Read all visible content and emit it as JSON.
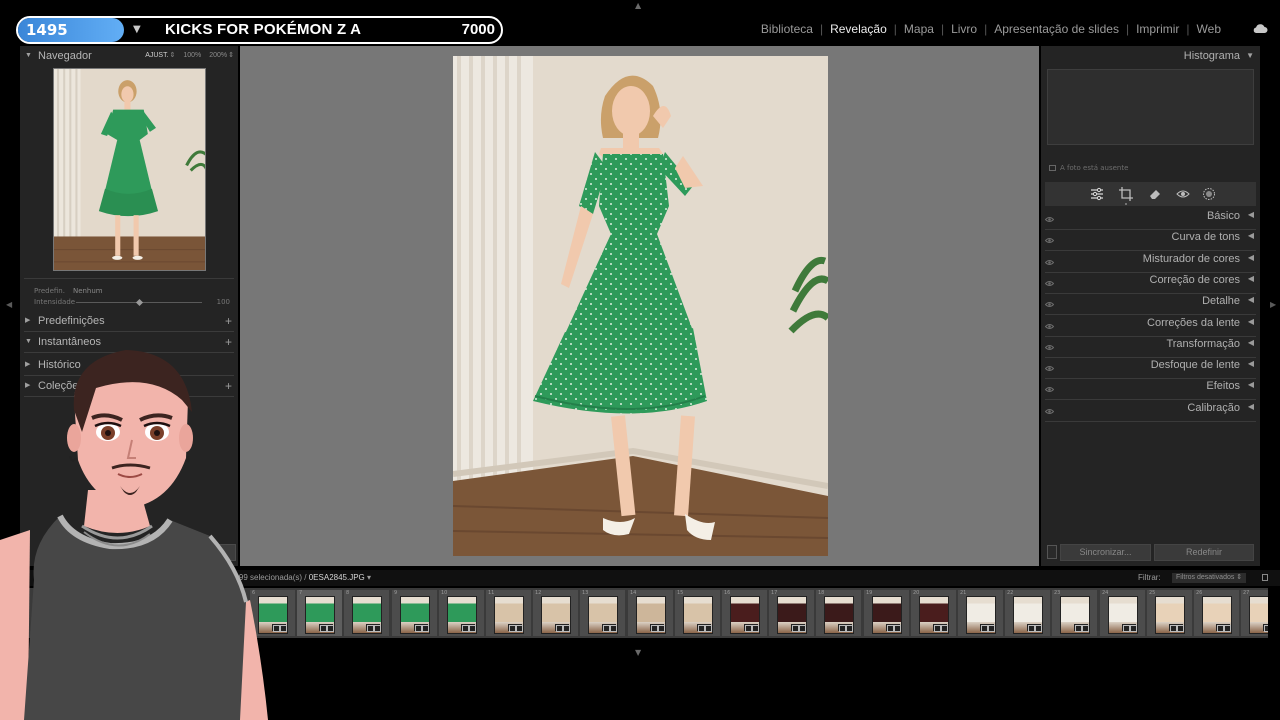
{
  "stream_overlay": {
    "counter": "1495",
    "title": "KICKS FOR POKÉMON Z A",
    "goal": "7000"
  },
  "modules": [
    {
      "label": "Biblioteca",
      "active": false
    },
    {
      "label": "Revelação",
      "active": true
    },
    {
      "label": "Mapa",
      "active": false
    },
    {
      "label": "Livro",
      "active": false
    },
    {
      "label": "Apresentação de slides",
      "active": false
    },
    {
      "label": "Imprimir",
      "active": false
    },
    {
      "label": "Web",
      "active": false
    }
  ],
  "left_panel": {
    "navigator": {
      "title": "Navegador",
      "zoom_options": [
        "AJUST.",
        "100%",
        "200%"
      ],
      "active_zoom": "AJUST."
    },
    "preset": {
      "label": "Predefin.",
      "value": "Nenhum"
    },
    "intensity": {
      "label": "Intensidade",
      "value": "100"
    },
    "sections": [
      {
        "label": "Predefinições",
        "expanded": false,
        "has_add": true
      },
      {
        "label": "Instantâneos",
        "expanded": true,
        "has_add": true
      },
      {
        "label": "Histórico",
        "expanded": false,
        "has_add": false
      },
      {
        "label": "Coleções",
        "expanded": false,
        "has_add": true
      }
    ]
  },
  "right_panel": {
    "histogram": {
      "title": "Histograma",
      "message": "A foto está ausente"
    },
    "tools": [
      "sliders-icon",
      "crop-icon",
      "eraser-icon",
      "red-eye-icon",
      "masking-icon"
    ],
    "panels": [
      "Básico",
      "Curva de tons",
      "Misturador de cores",
      "Correção de cores",
      "Detalhe",
      "Correções da lente",
      "Transformação",
      "Desfoque de lente",
      "Efeitos",
      "Calibração"
    ],
    "sync_label": "Sincronizar...",
    "reset_label": "Redefinir"
  },
  "filmstrip": {
    "info_prefix": "/ 199 selecionada(s) /",
    "filename": "0ESA2845.JPG",
    "filter_label": "Filtrar:",
    "filter_value": "Filtros desativados",
    "thumbs": [
      {
        "num": "6",
        "color": "#2e9a5a",
        "selected": false
      },
      {
        "num": "7",
        "color": "#2e9a5a",
        "selected": true
      },
      {
        "num": "8",
        "color": "#2e9a5a",
        "selected": false
      },
      {
        "num": "9",
        "color": "#2e9a5a",
        "selected": false
      },
      {
        "num": "10",
        "color": "#2e9a5a",
        "selected": false
      },
      {
        "num": "11",
        "color": "#d8c3a8",
        "selected": false
      },
      {
        "num": "12",
        "color": "#d8c3a8",
        "selected": false
      },
      {
        "num": "13",
        "color": "#d8c3a8",
        "selected": false
      },
      {
        "num": "14",
        "color": "#cdb69a",
        "selected": false
      },
      {
        "num": "15",
        "color": "#d8c3a8",
        "selected": false
      },
      {
        "num": "16",
        "color": "#4a1d1d",
        "selected": false
      },
      {
        "num": "17",
        "color": "#3b1a1a",
        "selected": false
      },
      {
        "num": "18",
        "color": "#3b1a1a",
        "selected": false
      },
      {
        "num": "19",
        "color": "#3b1a1a",
        "selected": false
      },
      {
        "num": "20",
        "color": "#4a1d1d",
        "selected": false
      },
      {
        "num": "21",
        "color": "#f0ece4",
        "selected": false
      },
      {
        "num": "22",
        "color": "#f0ece4",
        "selected": false
      },
      {
        "num": "23",
        "color": "#f0ece4",
        "selected": false
      },
      {
        "num": "24",
        "color": "#f0ece4",
        "selected": false
      },
      {
        "num": "25",
        "color": "#e8d2b8",
        "selected": false
      },
      {
        "num": "26",
        "color": "#e8d2b8",
        "selected": false
      },
      {
        "num": "27",
        "color": "#e8d2b8",
        "selected": false
      }
    ]
  },
  "colors": {
    "panel_bg": "#242424",
    "canvas_bg": "#777777",
    "dress_green": "#2e9a5a",
    "banner_blue": "#4b9be6"
  }
}
